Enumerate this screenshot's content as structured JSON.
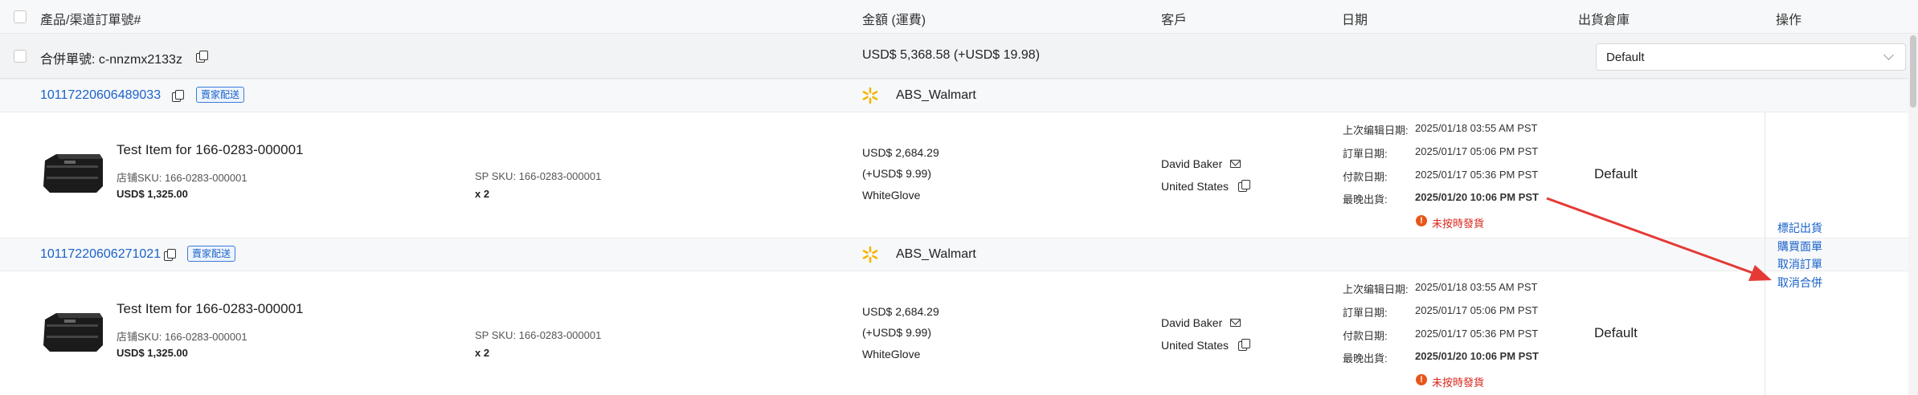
{
  "header": {
    "col_product": "產品/渠道訂單號#",
    "col_amount": "金額 (運費)",
    "col_customer": "客戶",
    "col_date": "日期",
    "col_warehouse": "出貨倉庫",
    "col_actions": "操作"
  },
  "merge": {
    "label": "合併單號: c-nnzmx2133z",
    "amount": "USD$ 5,368.58 (+USD$ 19.98)",
    "warehouse_selected": "Default"
  },
  "orders": [
    {
      "order_no": "10117220606489033",
      "tag": "賣家配送",
      "channel": "ABS_Walmart",
      "item_name": "Test Item for 166-0283-000001",
      "store_sku": "店铺SKU: 166-0283-000001",
      "price": "USD$ 1,325.00",
      "sp_sku": "SP SKU: 166-0283-000001",
      "qty": "x 2",
      "amount": "USD$ 2,684.29",
      "shipping": "(+USD$ 9.99)",
      "service": "WhiteGlove",
      "customer_name": "David Baker",
      "country": "United States",
      "last_edit_label": "上次编辑日期:",
      "last_edit": "2025/01/18 03:55 AM PST",
      "order_date_label": "訂單日期:",
      "order_date": "2025/01/17 05:06 PM PST",
      "pay_date_label": "付款日期:",
      "pay_date": "2025/01/17 05:36 PM PST",
      "latest_ship_label": "最晚出貨:",
      "latest_ship": "2025/01/20 10:06 PM PST",
      "late_status": "未按時發貨",
      "warehouse": "Default"
    },
    {
      "order_no": "10117220606271021",
      "tag": "賣家配送",
      "channel": "ABS_Walmart",
      "item_name": "Test Item for 166-0283-000001",
      "store_sku": "店铺SKU: 166-0283-000001",
      "price": "USD$ 1,325.00",
      "sp_sku": "SP SKU: 166-0283-000001",
      "qty": "x 2",
      "amount": "USD$ 2,684.29",
      "shipping": "(+USD$ 9.99)",
      "service": "WhiteGlove",
      "customer_name": "David Baker",
      "country": "United States",
      "last_edit_label": "上次编辑日期:",
      "last_edit": "2025/01/18 03:55 AM PST",
      "order_date_label": "訂單日期:",
      "order_date": "2025/01/17 05:06 PM PST",
      "pay_date_label": "付款日期:",
      "pay_date": "2025/01/17 05:36 PM PST",
      "latest_ship_label": "最晚出貨:",
      "latest_ship": "2025/01/20 10:06 PM PST",
      "late_status": "未按時發貨",
      "warehouse": "Default"
    }
  ],
  "actions": {
    "mark_shipped": "標記出貨",
    "buy_label": "購買面單",
    "cancel_order": "取消訂單",
    "cancel_merge": "取消合併"
  },
  "colors": {
    "link": "#1a62c9",
    "danger": "#d9261c",
    "warning": "#e8561a",
    "walmart": "#f5b400",
    "annotation_arrow": "#e53935"
  }
}
